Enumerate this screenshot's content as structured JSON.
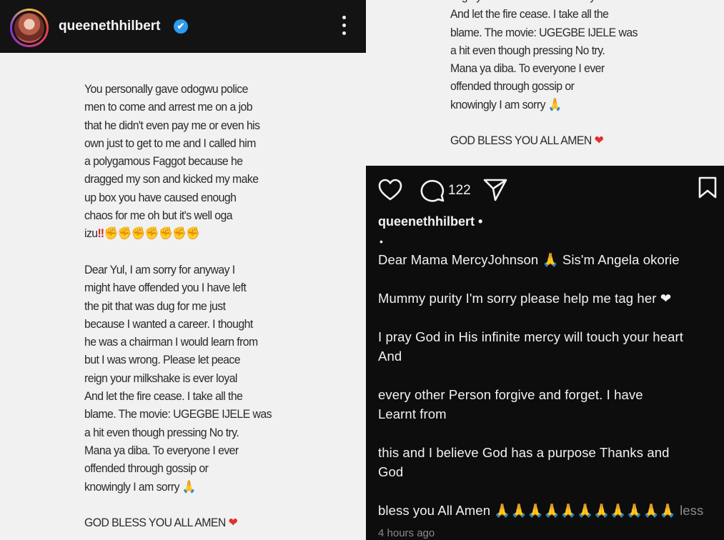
{
  "post": {
    "username": "queenethhilbert",
    "verified_icon": "✔",
    "note_left_lines": [
      "You personally gave odogwu police",
      "men to come and arrest me on a job",
      "that he didn't even pay me or even his",
      "own just to get to me and I called him",
      "a polygamous Faggot because he",
      "dragged my son and kicked my make",
      "up box you have caused enough",
      "chaos for me oh but it's well oga",
      "izu",
      "",
      "Dear Yul, I am sorry for anyway I",
      "might have offended you I have left",
      "the pit that was dug for me just",
      "because I wanted a career. I thought",
      "he was a chairman I would learn from",
      "but I was wrong. Please let peace",
      "reign your milkshake is ever loyal",
      "And let the fire cease. I take all the",
      "blame.  The movie: UGEGBE IJELE was",
      "a hit even though pressing No try.",
      "Mana ya diba. To everyone I ever",
      "offended through gossip or",
      "knowingly I am sorry",
      "",
      "GOD BLESS YOU ALL AMEN"
    ],
    "emojis": {
      "bang": "‼",
      "punches": "✊✊✊✊✊✊✊",
      "pray": "🙏",
      "heart": "❤"
    },
    "note_right_lines": [
      "reign your milkshake is ever loyal",
      "And let the fire cease. I take all the",
      "blame.  The movie: UGEGBE IJELE was",
      "a hit even though pressing No try.",
      "Mana ya diba. To everyone I ever",
      "offended through gossip or",
      "knowingly I am sorry",
      "",
      "GOD BLESS YOU ALL AMEN"
    ],
    "comment_count": "122",
    "caption_username": "queenethhilbert •",
    "caption_bullet": "•",
    "caption_lines": [
      "Dear Mama MercyJohnson 🙏 Sis'm Angela okorie",
      "Mummy purity I'm sorry please help me tag her ❤",
      "I pray God in His infinite mercy will touch your heart",
      "And",
      "every other Person forgive and forget. I have",
      "Learnt from",
      "this and I  believe God has a purpose Thanks and",
      "God",
      "bless you All Amen 🙏🙏🙏🙏🙏🙏🙏🙏🙏🙏🙏"
    ],
    "less_label": "less",
    "timestamp": "4 hours ago",
    "icons": [
      "heart-icon",
      "comment-icon",
      "share-icon",
      "bookmark-icon",
      "more-icon"
    ]
  }
}
